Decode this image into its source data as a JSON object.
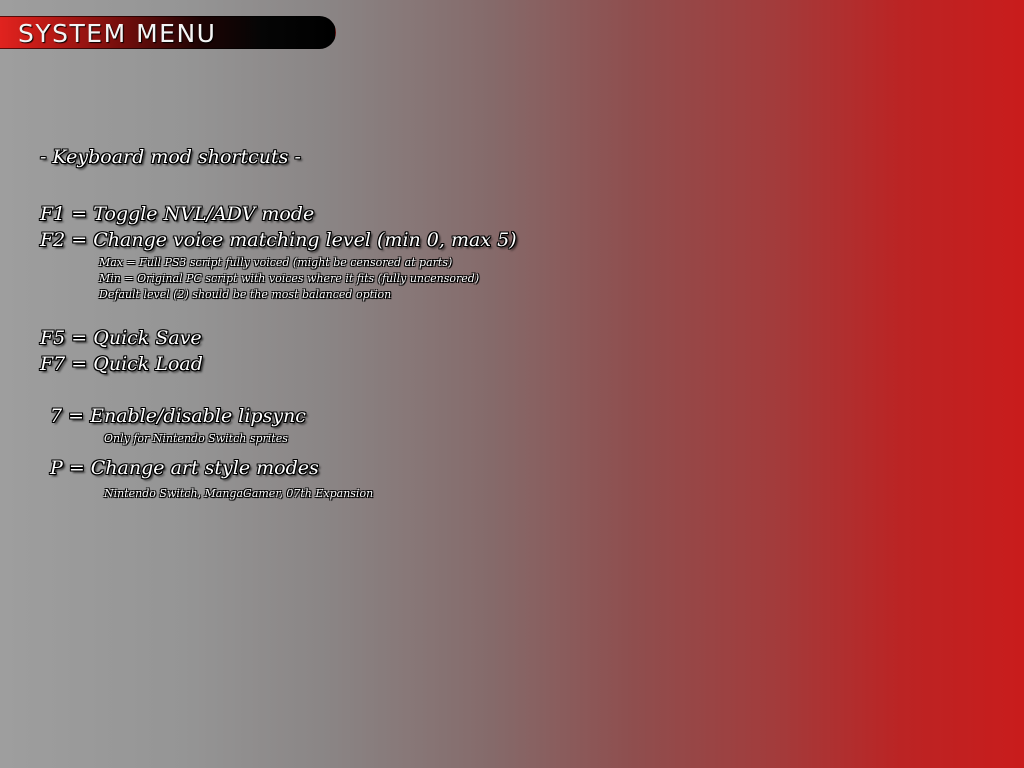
{
  "header": {
    "title": "SYSTEM MENU"
  },
  "content": {
    "section_title": "- Keyboard mod shortcuts -",
    "f1": "F1 = Toggle NVL/ADV mode",
    "f2": "F2 = Change voice matching level (min 0, max 5)",
    "f2_notes": [
      "Max = Full PS3 script fully voiced (might be censored at parts)",
      "Min = Original PC script with voices where it fits (fully uncensored)",
      "Default level (2) should be the most balanced option"
    ],
    "f5": "F5 = Quick Save",
    "f7": "F7 = Quick Load",
    "key7": "7 = Enable/disable lipsync",
    "key7_note": "Only for Nintendo Switch sprites",
    "keyP": "P = Change art style modes",
    "keyP_note": "Nintendo Switch, MangaGamer, 07th Expansion"
  },
  "colors": {
    "background_left": "#9e9e9e",
    "background_right": "#c91c1c",
    "title_accent": "#e1231f",
    "text": "#ffffff"
  }
}
